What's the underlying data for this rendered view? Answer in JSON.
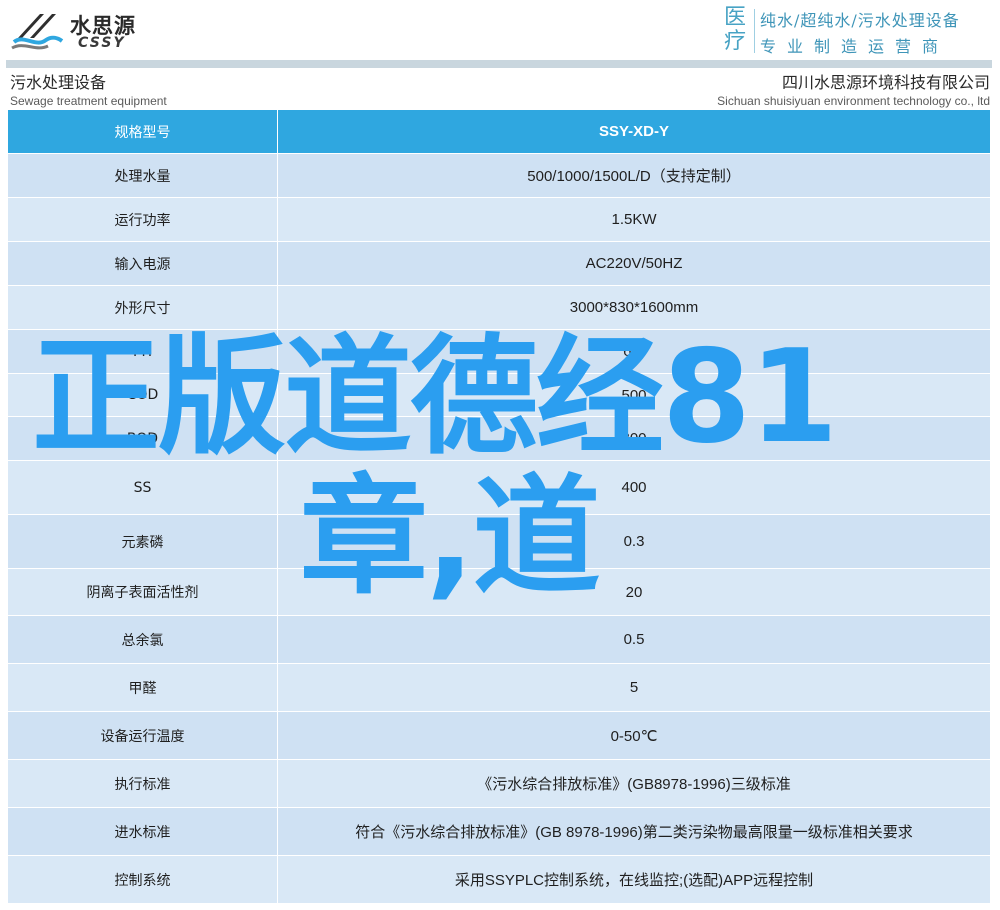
{
  "header": {
    "logo_cn": "水思源",
    "logo_en": "CSSY",
    "slogan_big": "医疗",
    "slogan_line1": "纯水/超纯水/污水处理设备",
    "slogan_line2": "专业制造运营商"
  },
  "subheader": {
    "left_cn": "污水处理设备",
    "left_en": "Sewage treatment equipment",
    "right_cn": "四川水思源环境科技有限公司",
    "right_en": "Sichuan shuisiyuan environment technology co., ltd"
  },
  "table": {
    "header": {
      "label": "规格型号",
      "value": "SSY-XD-Y"
    },
    "rows": [
      {
        "label": "处理水量",
        "value": "500/1000/1500L/D（支持定制）"
      },
      {
        "label": "运行功率",
        "value": "1.5KW"
      },
      {
        "label": "输入电源",
        "value": "AC220V/50HZ"
      },
      {
        "label": "外形尺寸",
        "value": "3000*830*1600mm"
      },
      {
        "label": "PH",
        "value": "6-9"
      },
      {
        "label": "COD",
        "value": "500"
      },
      {
        "label": "BOD",
        "value": "300"
      },
      {
        "label": "SS",
        "value": "400"
      },
      {
        "label": "元素磷",
        "value": "0.3"
      },
      {
        "label": "阴离子表面活性剂",
        "value": "20"
      },
      {
        "label": "总余氯",
        "value": "0.5"
      },
      {
        "label": "甲醛",
        "value": "5"
      },
      {
        "label": "设备运行温度",
        "value": "0-50℃"
      },
      {
        "label": "执行标准",
        "value": "《污水综合排放标准》(GB8978-1996)三级标准"
      },
      {
        "label": "进水标准",
        "value": "符合《污水综合排放标准》(GB 8978-1996)第二类污染物最高限量一级标准相关要求"
      },
      {
        "label": "控制系统",
        "value": "采用SSYPLC控制系统，在线监控;(选配)APP远程控制"
      }
    ]
  },
  "overlay": {
    "line1": "正版道德经81",
    "line2": "章,道"
  },
  "colors": {
    "table_header": "#2fa7e0",
    "row_light": "#cfe1f3",
    "row_alt": "#d9e8f6",
    "overlay_text": "#2b9ef0",
    "slogan": "#3f95b8"
  }
}
